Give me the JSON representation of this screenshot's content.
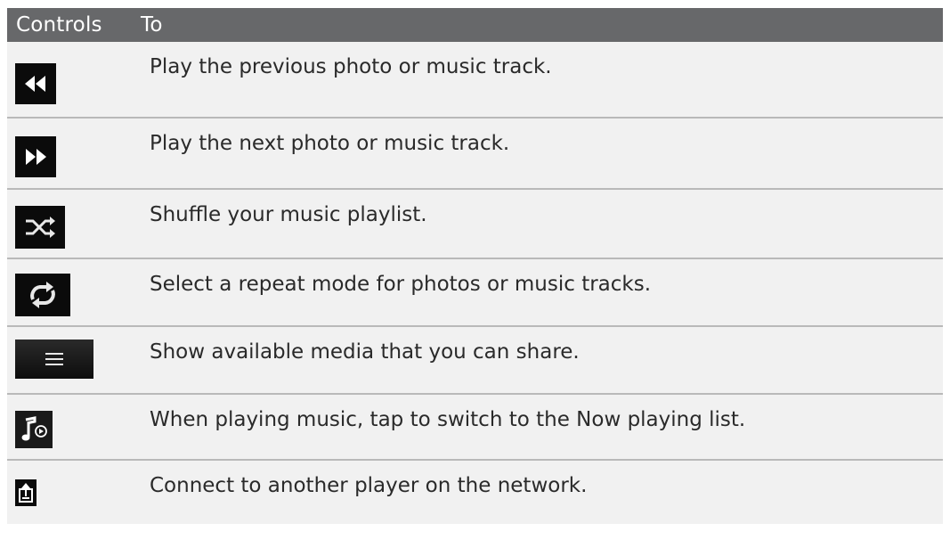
{
  "table": {
    "headers": {
      "controls": "Controls",
      "to": "To"
    },
    "rows": [
      {
        "icon": "rewind-icon",
        "text": "Play the previous photo or music track."
      },
      {
        "icon": "fast-forward-icon",
        "text": "Play the next photo or music track."
      },
      {
        "icon": "shuffle-icon",
        "text": "Shuffle your music playlist."
      },
      {
        "icon": "repeat-icon",
        "text": "Select a repeat mode for photos or music tracks."
      },
      {
        "icon": "menu-icon",
        "text": "Show available media that you can share."
      },
      {
        "icon": "now-playing-icon",
        "text": "When playing music, tap to switch to the Now playing list."
      },
      {
        "icon": "share-to-player-icon",
        "text": "Connect to another player on the network."
      }
    ]
  },
  "colors": {
    "header_bg": "#67686a",
    "row_bg": "#f1f1f1",
    "divider": "#b9b9b9",
    "icon_bg": "#0b0b0b"
  }
}
